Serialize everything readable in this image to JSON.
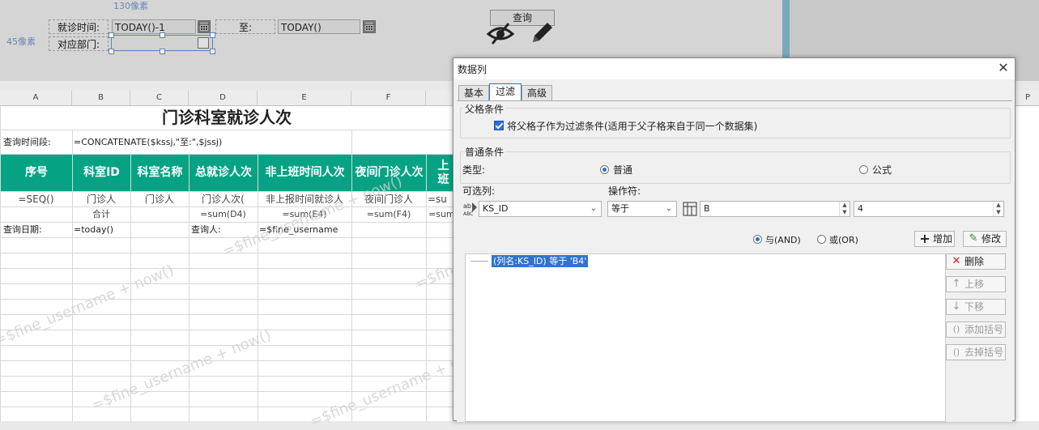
{
  "params": {
    "hint_top": "130像素",
    "hint_left": "45像素",
    "visit_time_label": "就诊时间:",
    "start_value": "TODAY()-1",
    "to_label": "至:",
    "end_value": "TODAY()",
    "dept_label": "对应部门:",
    "query_button": "查询"
  },
  "sheet": {
    "columns": [
      "A",
      "B",
      "C",
      "D",
      "E",
      "F",
      "P"
    ],
    "title": "门诊科室就诊人次",
    "row2_label": "查询时间段:",
    "row2_formula": "=CONCATENATE($kssj,\"至:\",$jssj)",
    "headers": [
      "序号",
      "科室ID",
      "科室名称",
      "总就诊人次",
      "非上班时间人次",
      "夜间门诊人次",
      "上班"
    ],
    "row4": [
      "=SEQ()",
      "门诊人",
      "门诊人",
      "门诊人次(",
      "非上报时间就诊人",
      "夜间门诊人",
      "=su"
    ],
    "row5": [
      "",
      "合计",
      "",
      "=sum(D4)",
      "=sum(E4)",
      "=sum(F4)",
      "=sum"
    ],
    "row6": [
      "查询日期:",
      "=today()",
      "",
      "查询人:",
      "=$fine_username"
    ],
    "watermarks": [
      "=$fine_username + now()",
      "=$fine_username + now()",
      "=$fine_username + now()",
      "=$fine_username + now()",
      "=$fine_username + now()"
    ]
  },
  "dialog": {
    "title": "数据列",
    "tabs": [
      "基本",
      "过滤",
      "高级"
    ],
    "parent_group": "父格条件",
    "parent_checkbox": "将父格子作为过滤条件(适用于父子格来自于同一个数据集)",
    "normal_group": "普通条件",
    "type_label": "类型:",
    "type_normal": "普通",
    "type_formula": "公式",
    "column_label": "可选列:",
    "operator_label": "操作符:",
    "column_value": "KS_ID",
    "operator_value": "等于",
    "cell_value": "B",
    "row_value": "4",
    "and_label": "与(AND)",
    "or_label": "或(OR)",
    "add_button": "增加",
    "modify_button": "修改",
    "condition_item": "(列名:KS_ID) 等于 'B4'",
    "delete_button": "删除",
    "up_button": "上移",
    "down_button": "下移",
    "add_paren_button": "添加括号",
    "remove_paren_button": "去掉括号",
    "colors": {
      "accent": "#2d6ed8",
      "header_green": "#05a383"
    }
  }
}
